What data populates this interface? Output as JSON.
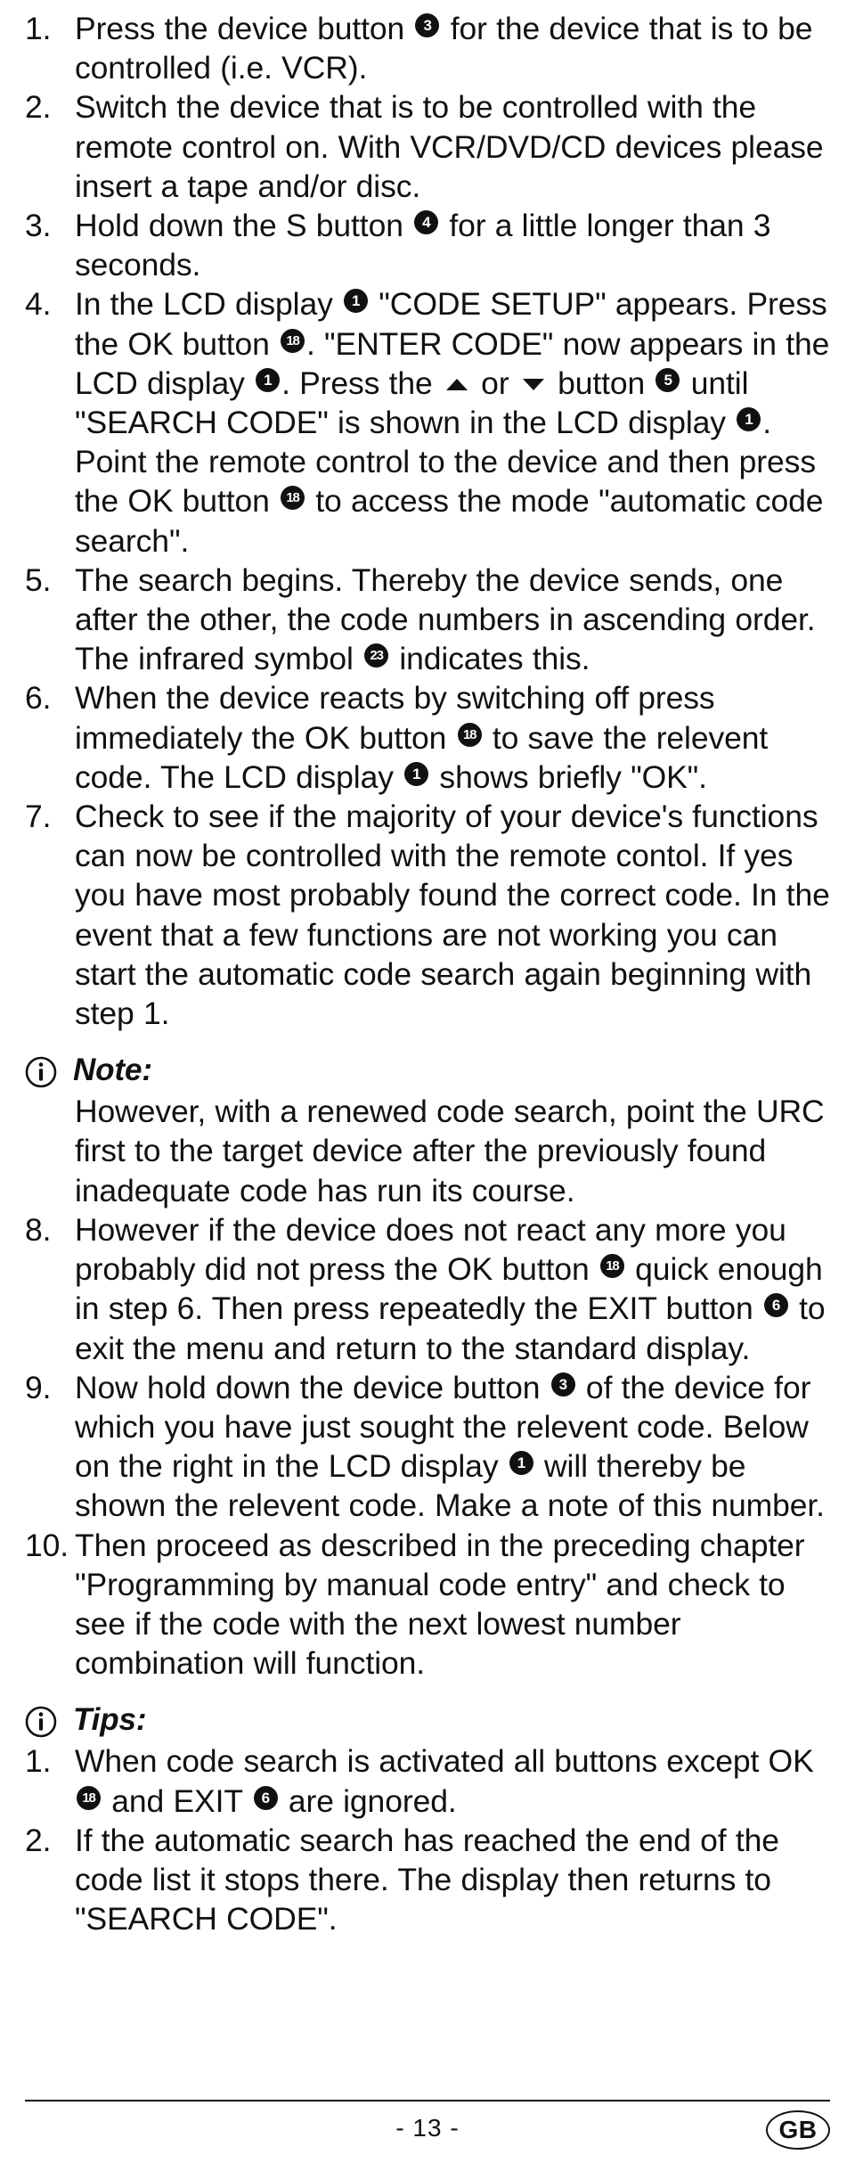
{
  "document": {
    "type": "instruction-manual-page",
    "language_badge": "GB",
    "page_number": "- 13 -"
  },
  "steps": [
    {
      "num": "1.",
      "segments": [
        {
          "t": "text",
          "v": "Press the device button "
        },
        {
          "t": "badge",
          "v": "3"
        },
        {
          "t": "text",
          "v": " for the device that is to be controlled (i.e. VCR)."
        }
      ]
    },
    {
      "num": "2.",
      "segments": [
        {
          "t": "text",
          "v": "Switch the device that is to be controlled with the remote control on. With VCR/DVD/CD devices please insert a tape and/or disc."
        }
      ]
    },
    {
      "num": "3.",
      "segments": [
        {
          "t": "text",
          "v": "Hold down the S button "
        },
        {
          "t": "badge",
          "v": "4"
        },
        {
          "t": "text",
          "v": " for a little longer than 3 seconds."
        }
      ]
    },
    {
      "num": "4.",
      "segments": [
        {
          "t": "text",
          "v": "In the LCD display "
        },
        {
          "t": "badge",
          "v": "1"
        },
        {
          "t": "text",
          "v": " \"CODE SETUP\" appears. Press the OK button "
        },
        {
          "t": "badge",
          "v": "18"
        },
        {
          "t": "text",
          "v": ". \"ENTER CODE\" now appears in the LCD display "
        },
        {
          "t": "badge",
          "v": "1"
        },
        {
          "t": "text",
          "v": ". Press the "
        },
        {
          "t": "arrow-up",
          "v": "up-arrow"
        },
        {
          "t": "text",
          "v": " or "
        },
        {
          "t": "arrow-down",
          "v": "down-arrow"
        },
        {
          "t": "text",
          "v": " button "
        },
        {
          "t": "badge",
          "v": "5"
        },
        {
          "t": "text",
          "v": " until \"SEARCH CODE\" is shown in the LCD display "
        },
        {
          "t": "badge",
          "v": "1"
        },
        {
          "t": "text",
          "v": ". Point the remote control to the device and then press the OK button "
        },
        {
          "t": "badge",
          "v": "18"
        },
        {
          "t": "text",
          "v": " to access the mode \"automatic code search\"."
        }
      ]
    },
    {
      "num": "5.",
      "segments": [
        {
          "t": "text",
          "v": "The search begins. Thereby the device sends, one after the other, the code numbers in ascending order. The infrared symbol "
        },
        {
          "t": "badge",
          "v": "23"
        },
        {
          "t": "text",
          "v": " indicates this."
        }
      ]
    },
    {
      "num": "6.",
      "segments": [
        {
          "t": "text",
          "v": "When the device reacts by switching off press immediately the OK button "
        },
        {
          "t": "badge",
          "v": "18"
        },
        {
          "t": "text",
          "v": " to save the relevent code. The LCD display "
        },
        {
          "t": "badge",
          "v": "1"
        },
        {
          "t": "text",
          "v": " shows briefly \"OK\"."
        }
      ]
    },
    {
      "num": "7.",
      "segments": [
        {
          "t": "text",
          "v": "Check to see if the majority of your device's functions can now be controlled with the remote contol. If yes you have most probably found the correct code. In the event that a few functions are not working you can start the automatic code search again beginning with step 1."
        }
      ]
    }
  ],
  "note": {
    "icon": "info-circle-icon",
    "title": "Note:",
    "body": "However, with a renewed code search, point the URC first to the target device after the previously found inadequate code has run its course."
  },
  "steps_after_note": [
    {
      "num": "8.",
      "segments": [
        {
          "t": "text",
          "v": "However if the device does not react any more you probably did not press the OK button "
        },
        {
          "t": "badge",
          "v": "18"
        },
        {
          "t": "text",
          "v": " quick enough in step 6. Then press repeatedly the EXIT button "
        },
        {
          "t": "badge",
          "v": "6"
        },
        {
          "t": "text",
          "v": " to exit the menu and return to the standard display."
        }
      ]
    },
    {
      "num": "9.",
      "segments": [
        {
          "t": "text",
          "v": "Now hold down the device button "
        },
        {
          "t": "badge",
          "v": "3"
        },
        {
          "t": "text",
          "v": " of the device for which you have just sought the relevent code. Below on the right in the LCD display "
        },
        {
          "t": "badge",
          "v": "1"
        },
        {
          "t": "text",
          "v": " will thereby be shown the relevent code. Make a note of this number."
        }
      ]
    },
    {
      "num": "10.",
      "segments": [
        {
          "t": "text",
          "v": "Then proceed as described in the preceding chapter \"Programming by manual code entry\" and check to see if the code with the next lowest number combination will function."
        }
      ]
    }
  ],
  "tips": {
    "icon": "info-circle-icon",
    "title": "Tips:",
    "items": [
      {
        "num": "1.",
        "segments": [
          {
            "t": "text",
            "v": "When code search is activated all buttons except OK "
          },
          {
            "t": "badge",
            "v": "18"
          },
          {
            "t": "text",
            "v": " and EXIT "
          },
          {
            "t": "badge",
            "v": "6"
          },
          {
            "t": "text",
            "v": " are ignored."
          }
        ]
      },
      {
        "num": "2.",
        "segments": [
          {
            "t": "text",
            "v": "If the automatic search has reached the end of the code list it stops there. The display then returns to \"SEARCH CODE\"."
          }
        ]
      }
    ]
  }
}
